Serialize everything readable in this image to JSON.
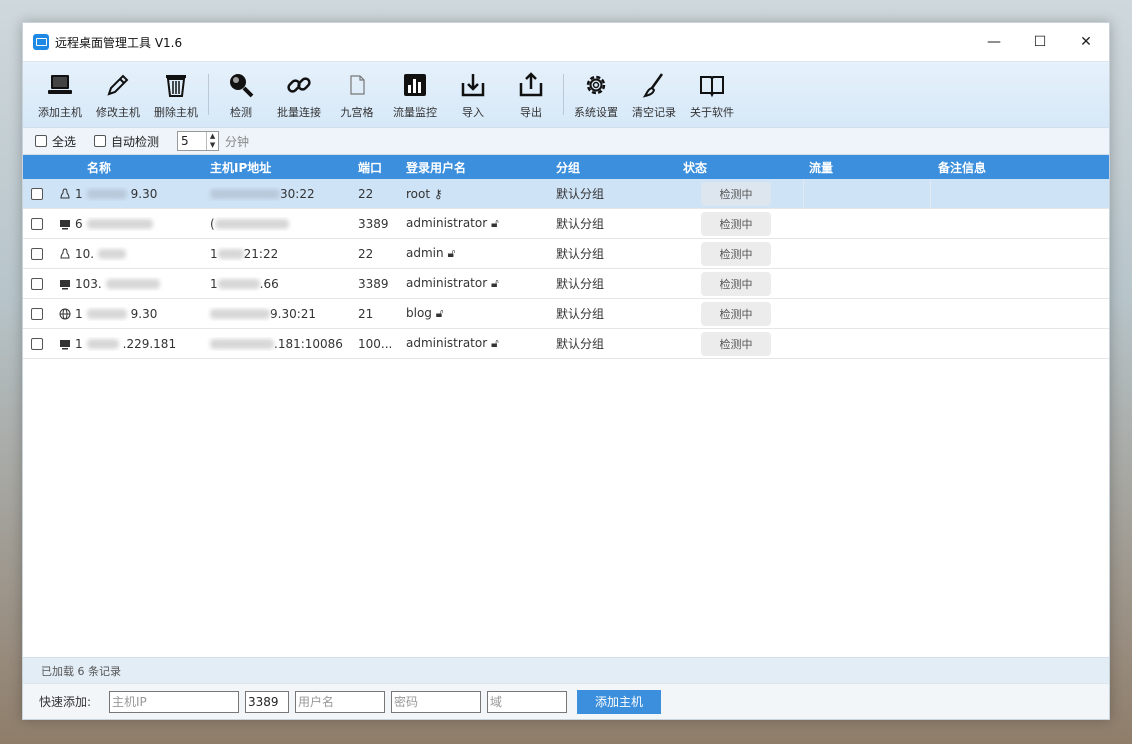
{
  "window": {
    "title": "远程桌面管理工具 V1.6",
    "minimize": "—",
    "maximize": "☐",
    "close": "✕"
  },
  "toolbar": {
    "items": [
      {
        "label": "添加主机",
        "icon": "laptop-icon"
      },
      {
        "label": "修改主机",
        "icon": "pencil-icon"
      },
      {
        "label": "删除主机",
        "icon": "trash-icon"
      },
      {
        "label": "检测",
        "icon": "search-icon"
      },
      {
        "label": "批量连接",
        "icon": "link-icon"
      },
      {
        "label": "九宫格",
        "icon": "document-icon"
      },
      {
        "label": "流量监控",
        "icon": "bar-chart-icon"
      },
      {
        "label": "导入",
        "icon": "import-icon"
      },
      {
        "label": "导出",
        "icon": "export-icon"
      },
      {
        "label": "系统设置",
        "icon": "gear-icon"
      },
      {
        "label": "清空记录",
        "icon": "brush-icon"
      },
      {
        "label": "关于软件",
        "icon": "book-icon"
      }
    ]
  },
  "options": {
    "select_all": "全选",
    "auto_detect": "自动检测",
    "interval": "5",
    "unit": "分钟"
  },
  "table": {
    "headers": [
      "名称",
      "主机IP地址",
      "端口",
      "登录用户名",
      "分组",
      "状态",
      "流量",
      "备注信息"
    ],
    "rows": [
      {
        "name_prefix": "1",
        "name_suffix": "9.30",
        "ip_prefix": "",
        "ip_suffix": "30:22",
        "port": "22",
        "user": "root",
        "user_icon": "key-icon",
        "group": "默认分组",
        "status": "检测中",
        "type_icon": "linux-icon"
      },
      {
        "name_prefix": "6",
        "name_suffix": "",
        "ip_prefix": "(",
        "ip_suffix": "",
        "port": "3389",
        "user": "administrator",
        "user_icon": "lock-icon",
        "group": "默认分组",
        "status": "检测中",
        "type_icon": "windows-icon"
      },
      {
        "name_prefix": "10.",
        "name_suffix": "",
        "ip_prefix": "1",
        "ip_suffix": "21:22",
        "port": "22",
        "user": "admin",
        "user_icon": "lock-icon",
        "group": "默认分组",
        "status": "检测中",
        "type_icon": "linux-icon"
      },
      {
        "name_prefix": "103.",
        "name_suffix": "",
        "ip_prefix": "1",
        "ip_suffix": ".66",
        "port": "3389",
        "user": "administrator",
        "user_icon": "lock-icon",
        "group": "默认分组",
        "status": "检测中",
        "type_icon": "windows-icon"
      },
      {
        "name_prefix": "1",
        "name_suffix": "9.30",
        "ip_prefix": "",
        "ip_suffix": "9.30:21",
        "port": "21",
        "user": "blog",
        "user_icon": "lock-icon",
        "group": "默认分组",
        "status": "检测中",
        "type_icon": "globe-icon"
      },
      {
        "name_prefix": "1",
        "name_suffix": ".229.181",
        "ip_prefix": "",
        "ip_suffix": ".181:10086",
        "port": "100...",
        "user": "administrator",
        "user_icon": "lock-icon",
        "group": "默认分组",
        "status": "检测中",
        "type_icon": "windows-icon"
      }
    ]
  },
  "status_bar": {
    "text": "已加载 6 条记录"
  },
  "quick_add": {
    "label": "快速添加:",
    "ip_placeholder": "主机IP",
    "port_value": "3389",
    "user_placeholder": "用户名",
    "password_placeholder": "密码",
    "domain_placeholder": "域",
    "button": "添加主机"
  },
  "colors": {
    "accent": "#3c8fdc",
    "selected_row": "#cfe3f7",
    "toolbar_bg": "#dce9f7"
  }
}
